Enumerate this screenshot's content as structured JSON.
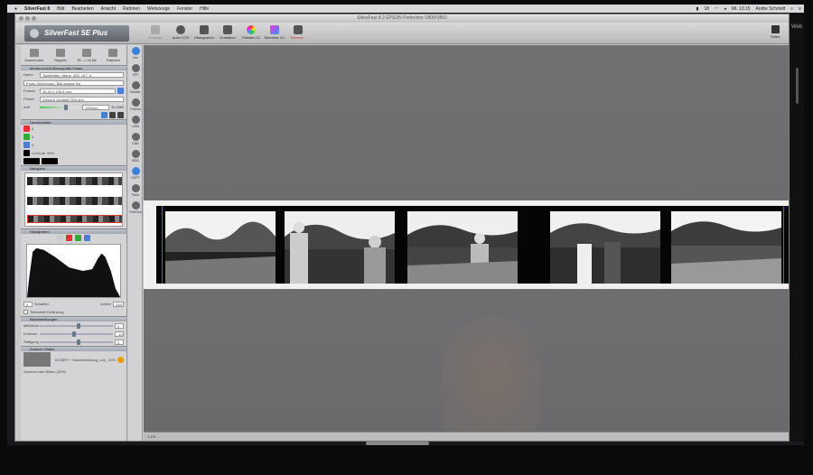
{
  "menubar": {
    "app_name": "SilverFast 8",
    "items": [
      "Bild",
      "Bearbeiten",
      "Ansicht",
      "Rahmen",
      "Werkzeuge",
      "Fenster",
      "Hilfe"
    ],
    "clock": "Mi. 13:15",
    "user": "Andre Schmidt",
    "battery": "18"
  },
  "window": {
    "title": "SilverFast 8.2 EPSON Perfection V800/V850"
  },
  "toolbar": {
    "logo_text": "SilverFast SE Plus",
    "tools": [
      {
        "label": "Prescan",
        "disabled": true
      },
      {
        "label": "Auto-CCR",
        "disabled": false
      },
      {
        "label": "Histogramm",
        "disabled": false
      },
      {
        "label": "Gradation",
        "disabled": false
      },
      {
        "label": "Globale CC",
        "disabled": false
      },
      {
        "label": "Selective CC",
        "disabled": false
      },
      {
        "label": "Scanner...",
        "disabled": false
      }
    ],
    "share_label": "Teilen"
  },
  "sidebar": {
    "top_icons": [
      "Scanmodus",
      "Negafix",
      "RL -> 16 Bit",
      "Rahmen"
    ],
    "panel_scan": {
      "title": "Modus und Auflösung des Scans",
      "name_label": "Name",
      "name_value": "Tadstreifen_Maue_083_167_6",
      "preset_value": "Photo Zeichnung / Bild analog fon",
      "format_label": "Format",
      "format_value": "35,40 x 135,0 mm",
      "preset_label": "Preset",
      "preset2_value": "Gesamt Qualität (300 dpi)",
      "aufl_label": "Aufl",
      "aufl_value": "3200ppi",
      "size_value": "30.3MB"
    },
    "panel_densitometer": {
      "title": "Densitometer",
      "values": [
        "0",
        "0",
        "0"
      ],
      "mode": "LCh/Lab",
      "percent": "90%"
    },
    "panel_navigator": {
      "title": "Navigator"
    },
    "panel_histogram": {
      "title": "Histogramm",
      "shadow_label": "Schatten",
      "light_label": "Lichter",
      "shadow_value": "0",
      "light_value": "255",
      "option_label": "Tiefenhell Einfärbung"
    },
    "panel_image": {
      "title": "Bildeinstellungen",
      "rows": [
        {
          "label": "Mitteltöne",
          "value": "0"
        },
        {
          "label": "Kontrast",
          "value": "-10"
        },
        {
          "label": "Sättigung",
          "value": "0"
        }
      ]
    },
    "panel_status": {
      "title": "Scanner Status",
      "file_line": "51GBPI + 'Dateiv/erteilung_von_andre/d...",
      "percent": "20%",
      "status_text": "Scannen des Bildes (20%)"
    }
  },
  "toolcolumn": {
    "tools": [
      "Info",
      "IPR",
      "Smartb.",
      "Frames",
      "USM",
      "GND",
      "iSRD",
      "DSPT",
      "Pano",
      "PrintTool"
    ]
  },
  "bottom_status": "1:1%",
  "right_edge_text": "Web"
}
